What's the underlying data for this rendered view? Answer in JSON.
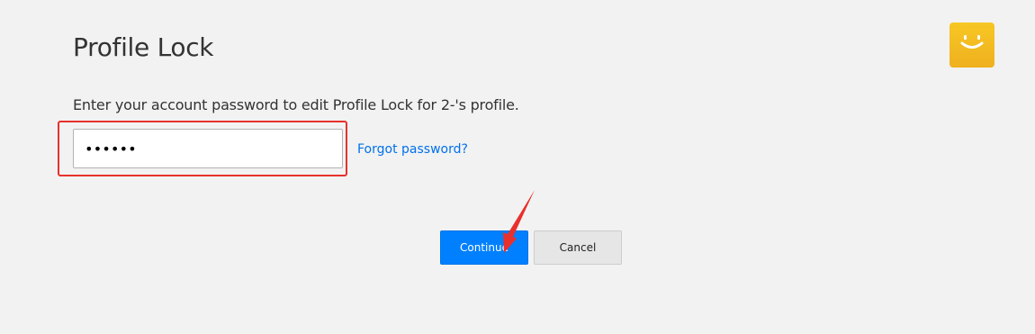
{
  "page": {
    "title": "Profile Lock",
    "instruction": "Enter your account password to edit Profile Lock for 2-'s profile."
  },
  "form": {
    "password_value": "••••••",
    "forgot_link": "Forgot password?"
  },
  "actions": {
    "continue_label": "Continue",
    "cancel_label": "Cancel"
  },
  "avatar": {
    "icon": "smiley-face-icon",
    "color": "#f3bd22"
  },
  "annotations": {
    "highlight_color": "#e8302c",
    "arrow_color": "#e8302c"
  },
  "colors": {
    "background": "#f2f2f2",
    "link": "#0071eb",
    "primary_button": "#0080ff",
    "secondary_button": "#e6e6e6"
  }
}
